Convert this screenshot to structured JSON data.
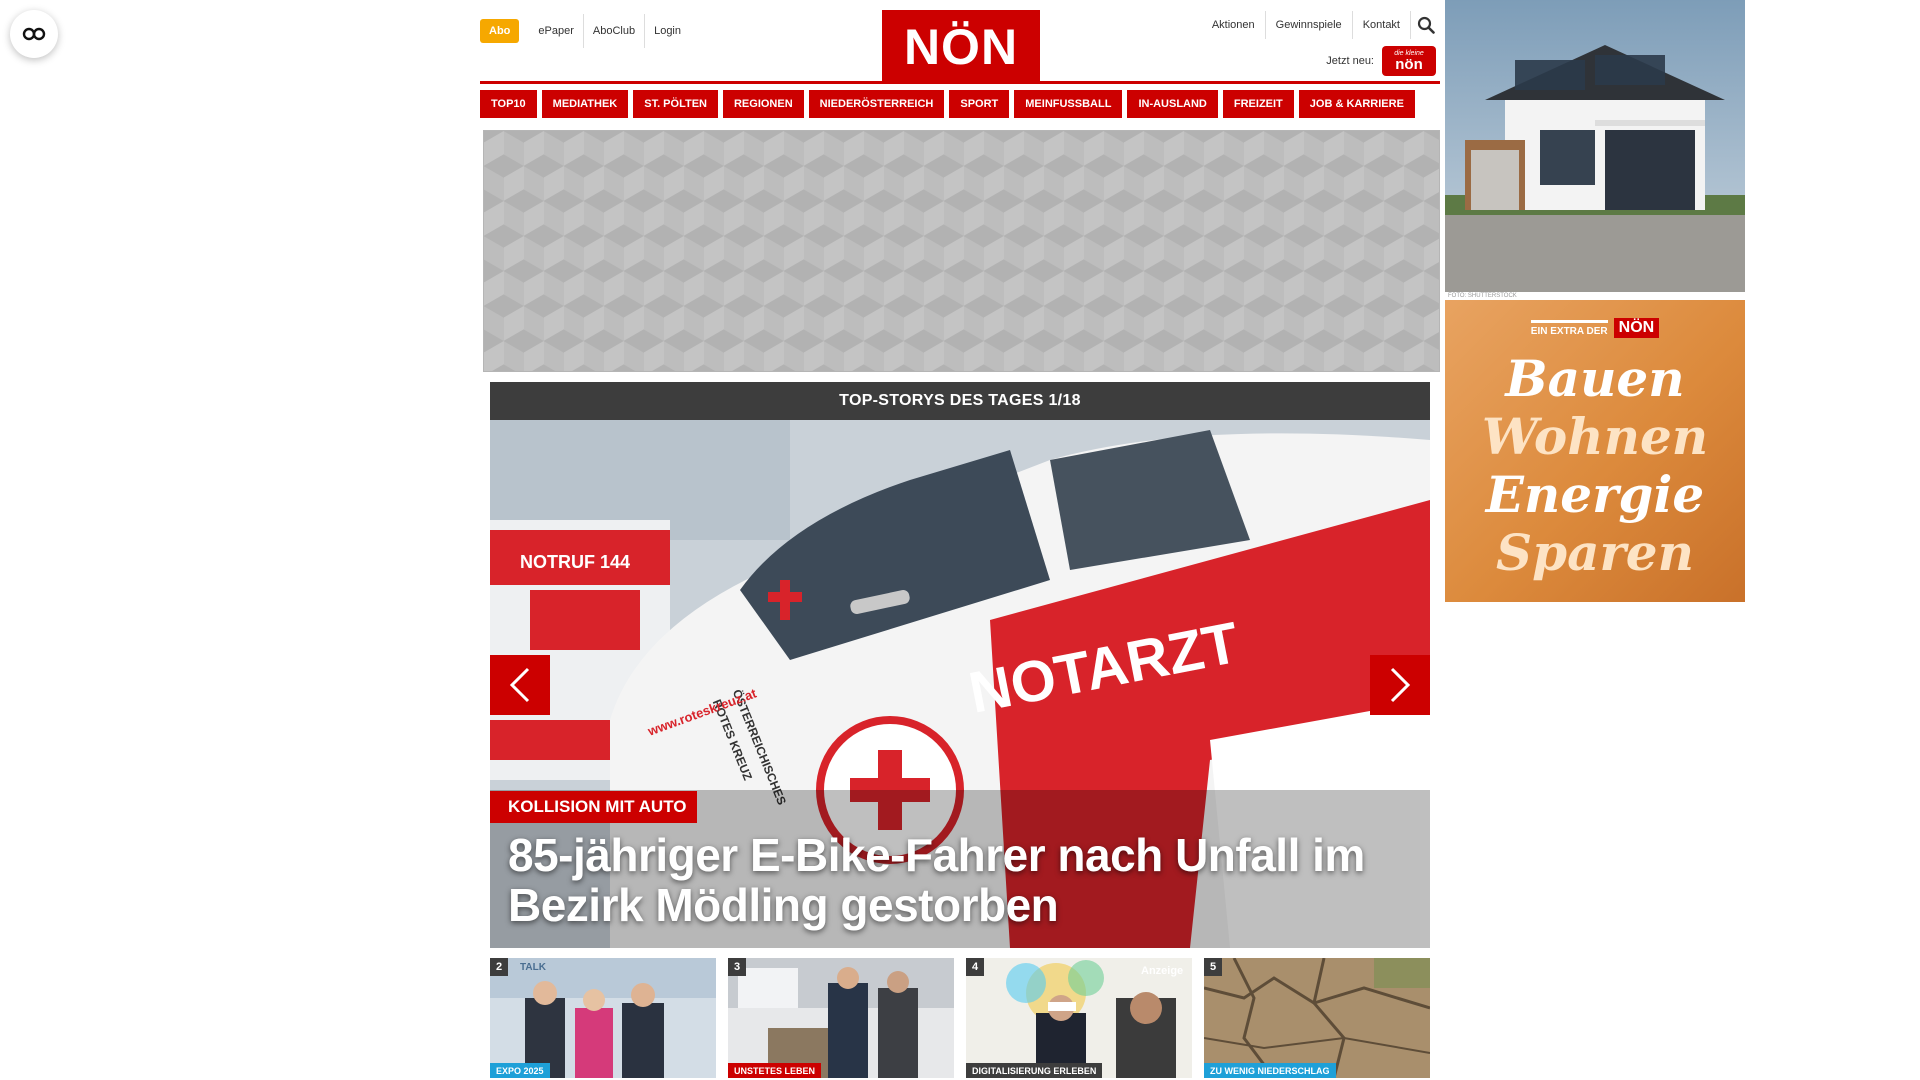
{
  "header": {
    "abo": "Abo",
    "left_links": [
      "ePaper",
      "AboClub",
      "Login"
    ],
    "logo": "NÖN",
    "right_links": [
      "Aktionen",
      "Gewinnspiele",
      "Kontakt"
    ],
    "jetzt_label": "Jetzt neu:",
    "jetzt_badge_top": "die kleine",
    "jetzt_badge_main": "nön"
  },
  "nav": [
    "TOP10",
    "MEDIATHEK",
    "ST. PÖLTEN",
    "REGIONEN",
    "NIEDERÖSTERREICH",
    "SPORT",
    "MEINFUSSBALL",
    "IN-AUSLAND",
    "FREIZEIT",
    "JOB & KARRIERE"
  ],
  "stories": {
    "title": "TOP-STORYS DES TAGES 1/18",
    "hero": {
      "kicker": "KOLLISION MIT AUTO",
      "headline": "85-jähriger E-Bike-Fahrer nach Unfall im Bezirk Mödling gestorben",
      "car_text": "NOTARZT",
      "ambulance_text": "NOTRUF 144",
      "door_text_1": "ÖSTERREICHISCHES",
      "door_text_2": "ROTES KREUZ",
      "url_text": "www.roteskreuz.at"
    },
    "thumbs": [
      {
        "num": "2",
        "tag": "EXPO 2025",
        "tag_color": "#1ea0d8",
        "corner": "TALK"
      },
      {
        "num": "3",
        "tag": "UNSTETES LEBEN",
        "tag_color": "#cc0000",
        "corner": ""
      },
      {
        "num": "4",
        "tag": "DIGITALISIERUNG ERLEBEN",
        "tag_color": "#3d3d3d",
        "corner": "Anzeige"
      },
      {
        "num": "5",
        "tag": "ZU WENIG NIEDERSCHLAG",
        "tag_color": "#1ea0d8",
        "corner": ""
      }
    ]
  },
  "side_ad": {
    "caption": "FOTO: SHUTTERSTOCK",
    "extra_label": "EIN EXTRA DER",
    "extra_logo": "NÖN",
    "words": [
      "Bauen",
      "Wohnen",
      "Energie",
      "Sparen"
    ]
  },
  "colors": {
    "brand_red": "#cc0000",
    "abo_orange": "#f6a800",
    "dark_bar": "#3d3d3d"
  }
}
